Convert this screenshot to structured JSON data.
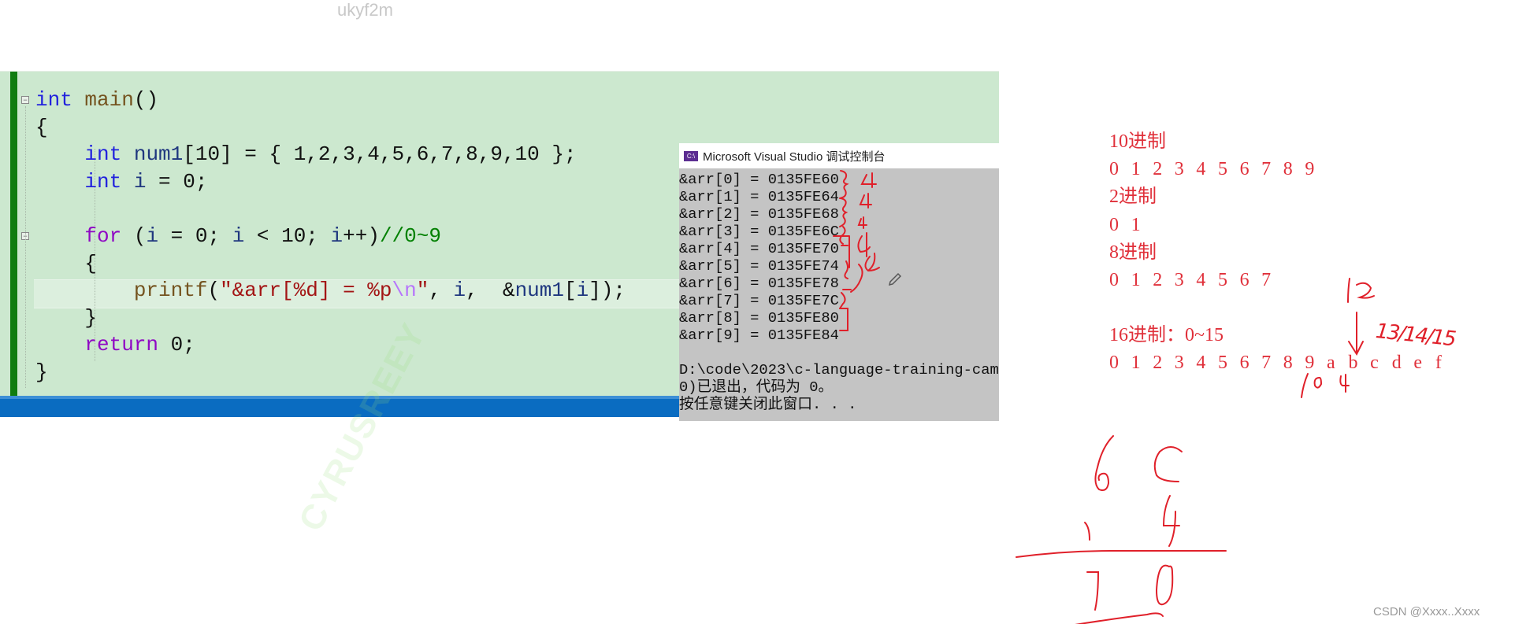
{
  "watermark_top": "ukyf2m",
  "watermark_diagonal": "CYRUSREEY",
  "editor": {
    "lines": [
      [
        [
          "int",
          "kw"
        ],
        [
          " ",
          "pl"
        ],
        [
          "main",
          "fn"
        ],
        [
          "()",
          "pl"
        ]
      ],
      [
        [
          "{",
          "pl"
        ]
      ],
      [
        [
          "    ",
          "pl"
        ],
        [
          "int",
          "kw"
        ],
        [
          " ",
          "pl"
        ],
        [
          "num1",
          "var"
        ],
        [
          "[10] = { 1,2,3,4,5,6,7,8,9,10 };",
          "pl"
        ]
      ],
      [
        [
          "    ",
          "pl"
        ],
        [
          "int",
          "kw"
        ],
        [
          " ",
          "pl"
        ],
        [
          "i",
          "var"
        ],
        [
          " = 0;",
          "pl"
        ]
      ],
      [
        [
          "",
          "pl"
        ]
      ],
      [
        [
          "    ",
          "pl"
        ],
        [
          "for",
          "ctl"
        ],
        [
          " (",
          "pl"
        ],
        [
          "i",
          "var"
        ],
        [
          " = 0; ",
          "pl"
        ],
        [
          "i",
          "var"
        ],
        [
          " < 10; ",
          "pl"
        ],
        [
          "i",
          "var"
        ],
        [
          "++)",
          "pl"
        ],
        [
          "//0~9",
          "cm"
        ]
      ],
      [
        [
          "    {",
          "pl"
        ]
      ],
      [
        [
          "        ",
          "pl"
        ],
        [
          "printf",
          "fn"
        ],
        [
          "(",
          "pl"
        ],
        [
          "\"&arr[%d] = %p",
          "str"
        ],
        [
          "\\n",
          "esc"
        ],
        [
          "\"",
          "str"
        ],
        [
          ", ",
          "pl"
        ],
        [
          "i",
          "var"
        ],
        [
          ",  &",
          "pl"
        ],
        [
          "num1",
          "var"
        ],
        [
          "[",
          "pl"
        ],
        [
          "i",
          "var"
        ],
        [
          "]);",
          "pl"
        ]
      ],
      [
        [
          "    }",
          "pl"
        ]
      ],
      [
        [
          "    ",
          "pl"
        ],
        [
          "return",
          "ctl"
        ],
        [
          " 0;",
          "pl"
        ]
      ],
      [
        [
          "}",
          "pl"
        ]
      ]
    ]
  },
  "console": {
    "title": "Microsoft Visual Studio 调试控制台",
    "icon": "vs-console-icon",
    "output_lines": [
      "&arr[0] = 0135FE60",
      "&arr[1] = 0135FE64",
      "&arr[2] = 0135FE68",
      "&arr[3] = 0135FE6C",
      "&arr[4] = 0135FE70",
      "&arr[5] = 0135FE74",
      "&arr[6] = 0135FE78",
      "&arr[7] = 0135FE7C",
      "&arr[8] = 0135FE80",
      "&arr[9] = 0135FE84",
      "",
      "D:\\code\\2023\\c-language-training-cam",
      "0)已退出，代码为 0。",
      "按任意键关闭此窗口. . ."
    ]
  },
  "notes": {
    "decimal_label": "10进制",
    "decimal_digits": [
      "0",
      "1",
      "2",
      "3",
      "4",
      "5",
      "6",
      "7",
      "8",
      "9"
    ],
    "binary_label": "2进制",
    "binary_digits": [
      "0",
      "1"
    ],
    "octal_label": "8进制",
    "octal_digits": [
      "0",
      "1",
      "2",
      "3",
      "4",
      "5",
      "6",
      "7"
    ],
    "hex_label": "16进制：0~15",
    "hex_digits": [
      "0",
      "1",
      "2",
      "3",
      "4",
      "5",
      "6",
      "7",
      "8",
      "9",
      "a",
      "b",
      "c",
      "d",
      "e",
      "f"
    ]
  },
  "handwriting": {
    "console_marks": [
      "4",
      "4",
      "4",
      "4",
      "4"
    ],
    "hex_marks": [
      "12",
      "13/14/15",
      "10",
      "4"
    ],
    "addition": {
      "top": "6 c",
      "plus": "1 4",
      "result": "7 0"
    }
  },
  "colors": {
    "accent_green": "#107c10",
    "editor_bg": "#cce8cf",
    "ink_red": "#e0303a",
    "status_blue": "#0a6cc1"
  },
  "footer": "CSDN @Xxxx..Xxxx"
}
